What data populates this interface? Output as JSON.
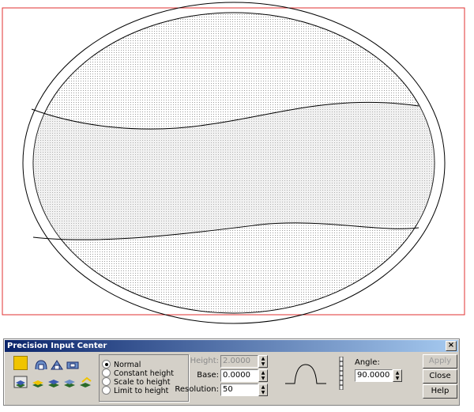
{
  "window": {
    "title": "Precision Input Center",
    "close_label": "×"
  },
  "radios": [
    {
      "label": "Normal",
      "selected": true
    },
    {
      "label": "Constant height",
      "selected": false
    },
    {
      "label": "Scale to height",
      "selected": false
    },
    {
      "label": "Limit to height",
      "selected": false
    }
  ],
  "fields": {
    "height_label": "Height:",
    "height_value": "2.0000",
    "base_label": "Base:",
    "base_value": "0.0000",
    "resolution_label": "Resolution:",
    "resolution_value": "50",
    "angle_label": "Angle:",
    "angle_value": "90.0000"
  },
  "buttons": {
    "apply": "Apply",
    "close": "Close",
    "help": "Help"
  },
  "colors": {
    "border": "#e03030",
    "swatch": "#f0c400",
    "titlebar": "#0a246a"
  }
}
